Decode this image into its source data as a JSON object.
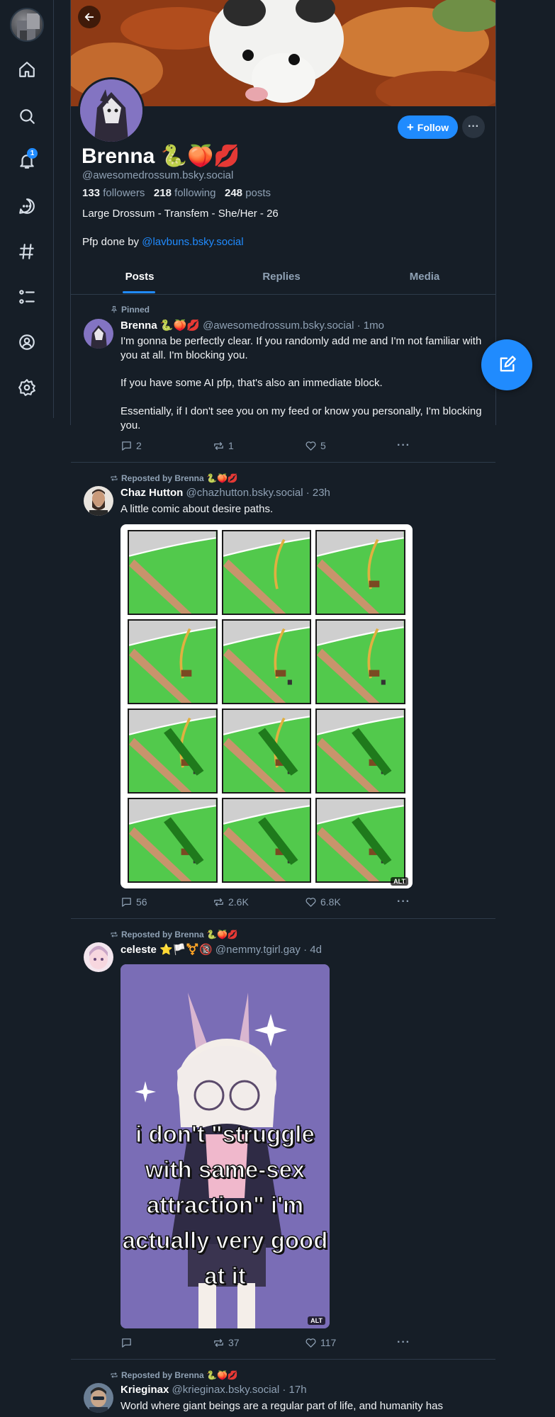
{
  "nav": {
    "notification_count": "1",
    "items": [
      "home",
      "search",
      "notifications",
      "chat",
      "feeds",
      "lists",
      "profile",
      "settings"
    ]
  },
  "profile": {
    "display_name": "Brenna 🐍🍑💋",
    "handle": "@awesomedrossum.bsky.social",
    "followers_count": "133",
    "followers_label": "followers",
    "following_count": "218",
    "following_label": "following",
    "posts_count": "248",
    "posts_label": "posts",
    "bio_line1": "Large Drossum - Transfem - She/Her - 26",
    "bio_pfp_prefix": "Pfp done by",
    "bio_pfp_link": "@lavbuns.bsky.social",
    "follow_label": "Follow"
  },
  "tabs": [
    "Posts",
    "Replies",
    "Media"
  ],
  "posts": [
    {
      "context": "Pinned",
      "author_name": "Brenna 🐍🍑💋",
      "author_handle": "@awesomedrossum.bsky.social",
      "age": "· 1mo",
      "text_1": "I'm gonna be perfectly clear. If you randomly add me and I'm not familiar with you at all. I'm blocking you.",
      "text_2": "If you have some AI pfp, that's also an immediate block.",
      "text_3": "Essentially, if I don't see you on my feed or know you personally, I'm blocking you.",
      "replies": "2",
      "reposts": "1",
      "likes": "5"
    },
    {
      "context": "Reposted by Brenna 🐍🍑💋",
      "author_name": "Chaz Hutton",
      "author_handle": "@chazhutton.bsky.social",
      "age": "· 23h",
      "text_1": "A little comic about desire paths.",
      "alt": "ALT",
      "replies": "56",
      "reposts": "2.6K",
      "likes": "6.8K"
    },
    {
      "context": "Reposted by Brenna 🐍🍑💋",
      "author_name": "celeste ⭐🏳️⚧️🔞",
      "author_handle": "@nemmy.tgirl.gay",
      "age": "· 4d",
      "image_caption": "i don't \"struggle with same-sex attraction\" i'm actually very good at it",
      "alt": "ALT",
      "replies": "",
      "reposts": "37",
      "likes": "117"
    },
    {
      "context": "Reposted by Brenna 🐍🍑💋",
      "author_name": "Krieginax",
      "author_handle": "@krieginax.bsky.social",
      "age": "· 17h",
      "text_1": "World where giant beings are a regular part of life, and humanity has"
    }
  ]
}
